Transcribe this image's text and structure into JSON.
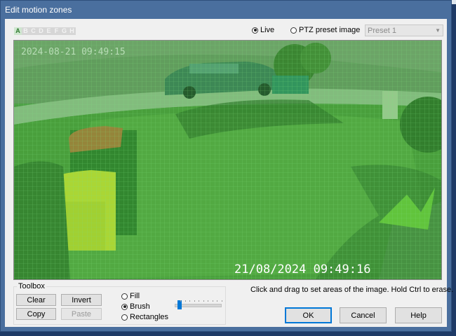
{
  "dialog": {
    "title": "Edit motion zones"
  },
  "zones": {
    "letters": [
      "A",
      "B",
      "C",
      "D",
      "E",
      "F",
      "G",
      "H"
    ],
    "active_index": 0,
    "active_color": "#2f7a2f"
  },
  "source": {
    "live_label": "Live",
    "live_checked": true,
    "ptz_label": "PTZ preset image",
    "ptz_checked": false,
    "preset_value": "Preset 1"
  },
  "camera": {
    "osd_top": "2024-08-21 09:49:15",
    "osd_bottom": "21/08/2024 09:49:16",
    "zone_overlay_color": "#3cd23c"
  },
  "toolbox": {
    "label": "Toolbox",
    "clear_label": "Clear",
    "invert_label": "Invert",
    "copy_label": "Copy",
    "paste_label": "Paste",
    "paste_enabled": false,
    "fill_label": "Fill",
    "brush_label": "Brush",
    "rectangles_label": "Rectangles",
    "selected_tool": "Brush",
    "brush_size_fraction": 0.05
  },
  "hint_text": "Click and drag to set areas of the image.  Hold Ctrl to erase.",
  "actions": {
    "ok_label": "OK",
    "cancel_label": "Cancel",
    "help_label": "Help"
  }
}
